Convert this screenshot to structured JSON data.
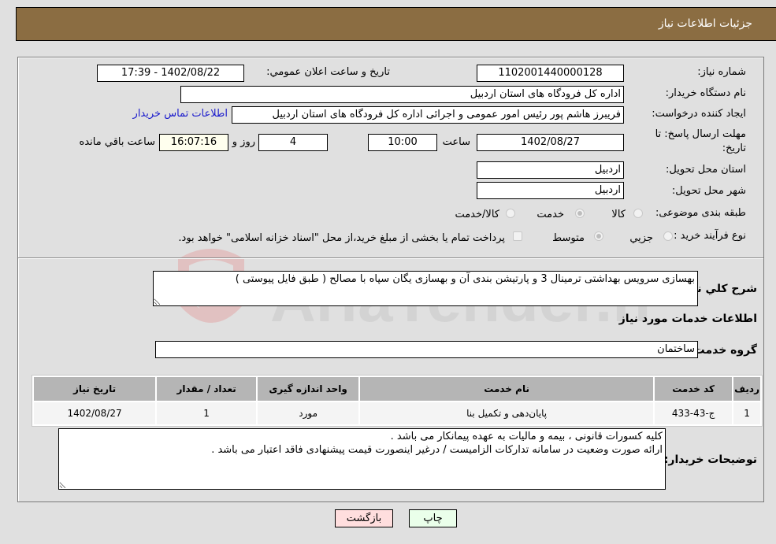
{
  "header": {
    "title": "جزئیات اطلاعات نیاز"
  },
  "form": {
    "need_number": {
      "label": "شماره نیاز:",
      "value": "1102001440000128"
    },
    "announce_datetime": {
      "label": "تاريخ و ساعت اعلان عمومي:",
      "value": "1402/08/22 - 17:39"
    },
    "buyer_org": {
      "label": "نام دستگاه خريدار:",
      "value": "اداره کل فرودگاه های استان اردبیل"
    },
    "requester": {
      "label": "ايجاد کننده درخواست:",
      "value": "فریبرز هاشم پور رئیس امور عمومی و اجرائی اداره کل فرودگاه های استان اردبیل",
      "contact_link": "اطلاعات تماس خريدار"
    },
    "deadline": {
      "label_line1": "مهلت ارسال پاسخ: تا",
      "label_line2": "تاريخ:",
      "date": "1402/08/27",
      "time_label": "ساعت",
      "time": "10:00",
      "days": "4",
      "days_label": "روز و",
      "remaining": "16:07:16",
      "remaining_label": "ساعت باقي مانده"
    },
    "province": {
      "label": "استان محل تحويل:",
      "value": "اردبیل"
    },
    "city": {
      "label": "شهر محل تحويل:",
      "value": "اردبیل"
    },
    "category": {
      "label": "طبقه بندی موضوعی:",
      "options": [
        {
          "label": "کالا",
          "checked": false
        },
        {
          "label": "خدمت",
          "checked": true
        },
        {
          "label": "کالا/خدمت",
          "checked": false
        }
      ]
    },
    "purchase_type": {
      "label": "نوع فرآيند خريد :",
      "options": [
        {
          "label": "جزيي",
          "checked": false
        },
        {
          "label": "متوسط",
          "checked": true
        }
      ],
      "treasury_note": "پرداخت تمام یا بخشی از مبلغ خرید،از محل \"اسناد خزانه اسلامی\" خواهد بود."
    },
    "description": {
      "label": "شرح کلي نياز:",
      "value": "بهسازی سرویس بهداشتی ترمینال 3 و پارتیشن بندی آن و بهسازی یگان سپاه با مصالح ( طبق فایل پیوستی )"
    },
    "services_section_title": "اطلاعات خدمات مورد نياز",
    "service_group": {
      "label": "گروه خدمت:",
      "value": "ساختمان"
    },
    "table": {
      "headers": [
        "رديف",
        "کد خدمت",
        "نام خدمت",
        "واحد اندازه گيری",
        "تعداد / مقدار",
        "تاريخ نياز"
      ],
      "rows": [
        [
          "1",
          "ج-43-433",
          "پایان‌دهی و تکمیل بنا",
          "مورد",
          "1",
          "1402/08/27"
        ]
      ]
    },
    "buyer_notes": {
      "label": "توضيحات خريدار:",
      "value": "کلیه کسورات قانونی ، بیمه و مالیات به عهده پیمانکار می باشد .\nارائه صورت وضعیت در سامانه تدارکات الزامیست / درغیر اینصورت قیمت پیشنهادی فاقد اعتبار می باشد ."
    }
  },
  "buttons": {
    "print": "چاپ",
    "back": "بازگشت"
  },
  "colors": {
    "header_bg": "#8b6d42",
    "print_bg": "#eaffea",
    "back_bg": "#ffdede",
    "link": "#1a1acc"
  }
}
